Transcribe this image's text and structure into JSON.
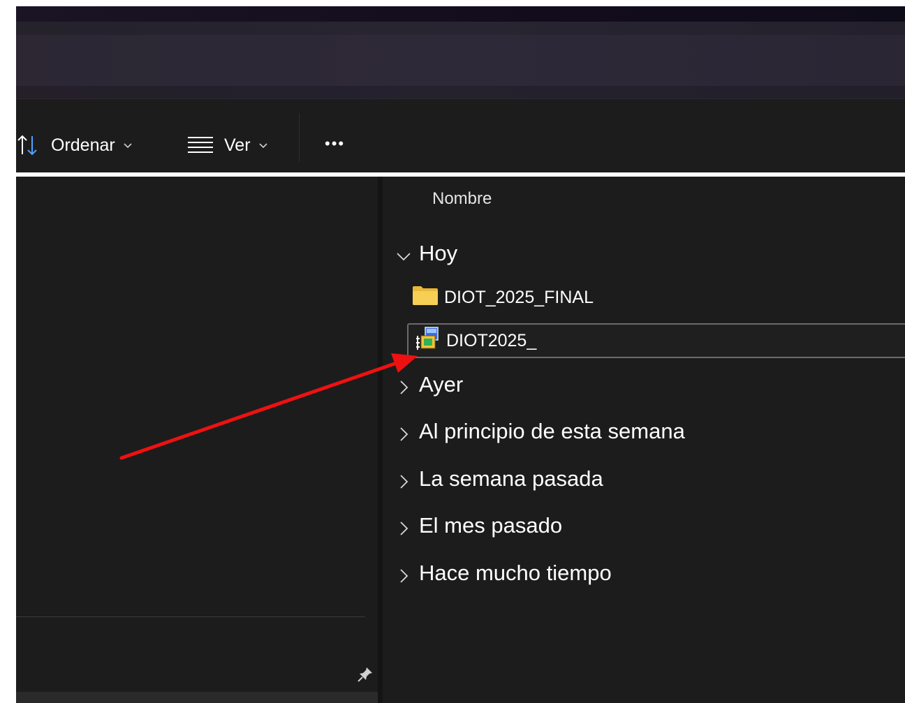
{
  "colors": {
    "background": "#1c1c1c",
    "accent_arrow": "#ee1111",
    "folder": "#f2c94c",
    "text": "#ffffff"
  },
  "toolbar": {
    "sort_icon": "sort-arrows-icon",
    "sort_label": "Ordenar",
    "view_icon": "list-view-icon",
    "view_label": "Ver",
    "more_label": "•••",
    "more_icon": "more-options-icon"
  },
  "file_list": {
    "column_header": "Nombre",
    "groups": [
      {
        "label": "Hoy",
        "expanded": true,
        "items": [
          {
            "name": "DIOT_2025_FINAL",
            "icon": "folder-icon",
            "selected": false
          },
          {
            "name": "DIOT2025_",
            "icon": "installer-icon",
            "selected": true
          }
        ]
      },
      {
        "label": "Ayer",
        "expanded": false
      },
      {
        "label": "Al principio de esta semana",
        "expanded": false
      },
      {
        "label": "La semana pasada",
        "expanded": false
      },
      {
        "label": "El mes pasado",
        "expanded": false
      },
      {
        "label": "Hace mucho tiempo",
        "expanded": false
      }
    ]
  },
  "navigation_pane": {
    "pin_icon": "pin-icon"
  }
}
